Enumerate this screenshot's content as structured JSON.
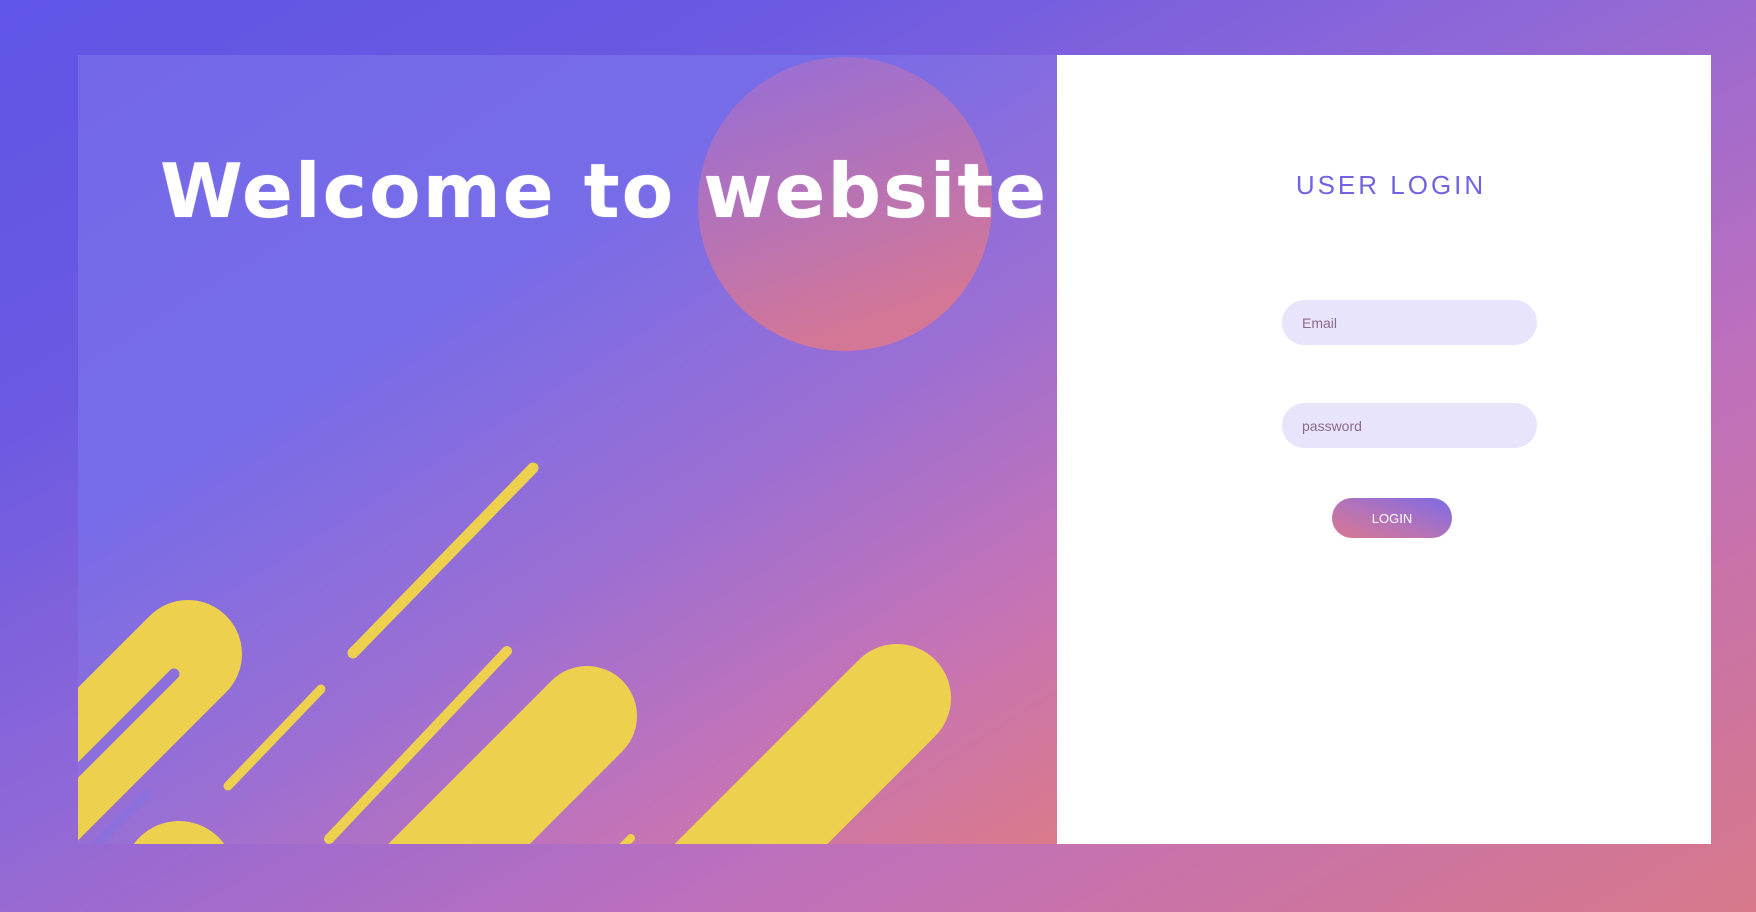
{
  "left": {
    "title": "Welcome to website"
  },
  "login": {
    "title": "USER LOGIN",
    "email_placeholder": "Email",
    "password_placeholder": "password",
    "button_label": "LOGIN"
  },
  "colors": {
    "accent": "#7064e4",
    "decor_yellow": "#eed04f",
    "field_bg": "#e8e4fc"
  }
}
